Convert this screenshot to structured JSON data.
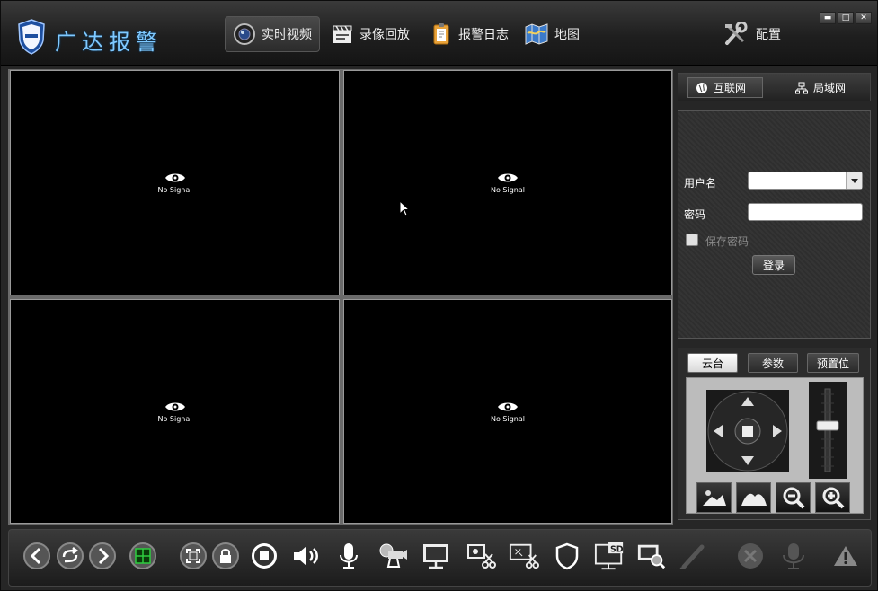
{
  "app": {
    "title": "广达报警"
  },
  "nav": [
    {
      "label": "实时视频",
      "icon": "camera-lens-icon",
      "active": true
    },
    {
      "label": "录像回放",
      "icon": "clapperboard-icon",
      "active": false
    },
    {
      "label": "报警日志",
      "icon": "clipboard-icon",
      "active": false
    },
    {
      "label": "地图",
      "icon": "map-icon",
      "active": false
    },
    {
      "label": "配置",
      "icon": "tools-icon",
      "active": false
    }
  ],
  "window_buttons": {
    "minimize": "▬",
    "maximize": "□",
    "close": "✕"
  },
  "video": {
    "cells": [
      {
        "status": "No Signal"
      },
      {
        "status": "No Signal"
      },
      {
        "status": "No Signal"
      },
      {
        "status": "No Signal"
      }
    ]
  },
  "network": {
    "tabs": [
      {
        "label": "互联网",
        "icon": "globe-icon",
        "active": true
      },
      {
        "label": "局域网",
        "icon": "lan-icon",
        "active": false
      }
    ]
  },
  "login": {
    "username_label": "用户名",
    "password_label": "密码",
    "username_value": "",
    "password_value": "",
    "remember_label": "保存密码",
    "remember_checked": false,
    "submit_label": "登录"
  },
  "ptz": {
    "tabs": [
      {
        "label": "云台",
        "active": true
      },
      {
        "label": "参数",
        "active": false
      },
      {
        "label": "预置位",
        "active": false
      }
    ],
    "buttons": [
      "focus-near-icon",
      "focus-far-icon",
      "zoom-out-icon",
      "zoom-in-icon"
    ]
  },
  "toolbar": {
    "icons": [
      "previous-icon",
      "refresh-icon",
      "next-icon",
      "grid-layout-icon",
      "fullscreen-icon",
      "lock-icon",
      "stop-icon",
      "volume-icon",
      "microphone-icon",
      "camera-setup-icon",
      "monitor-icon",
      "snapshot-cut-icon",
      "screen-cut-icon",
      "shield-icon",
      "sd-card-icon",
      "screen-zoom-icon",
      "pen-icon",
      "cancel-icon",
      "microphone-disabled-icon",
      "warning-icon"
    ]
  }
}
